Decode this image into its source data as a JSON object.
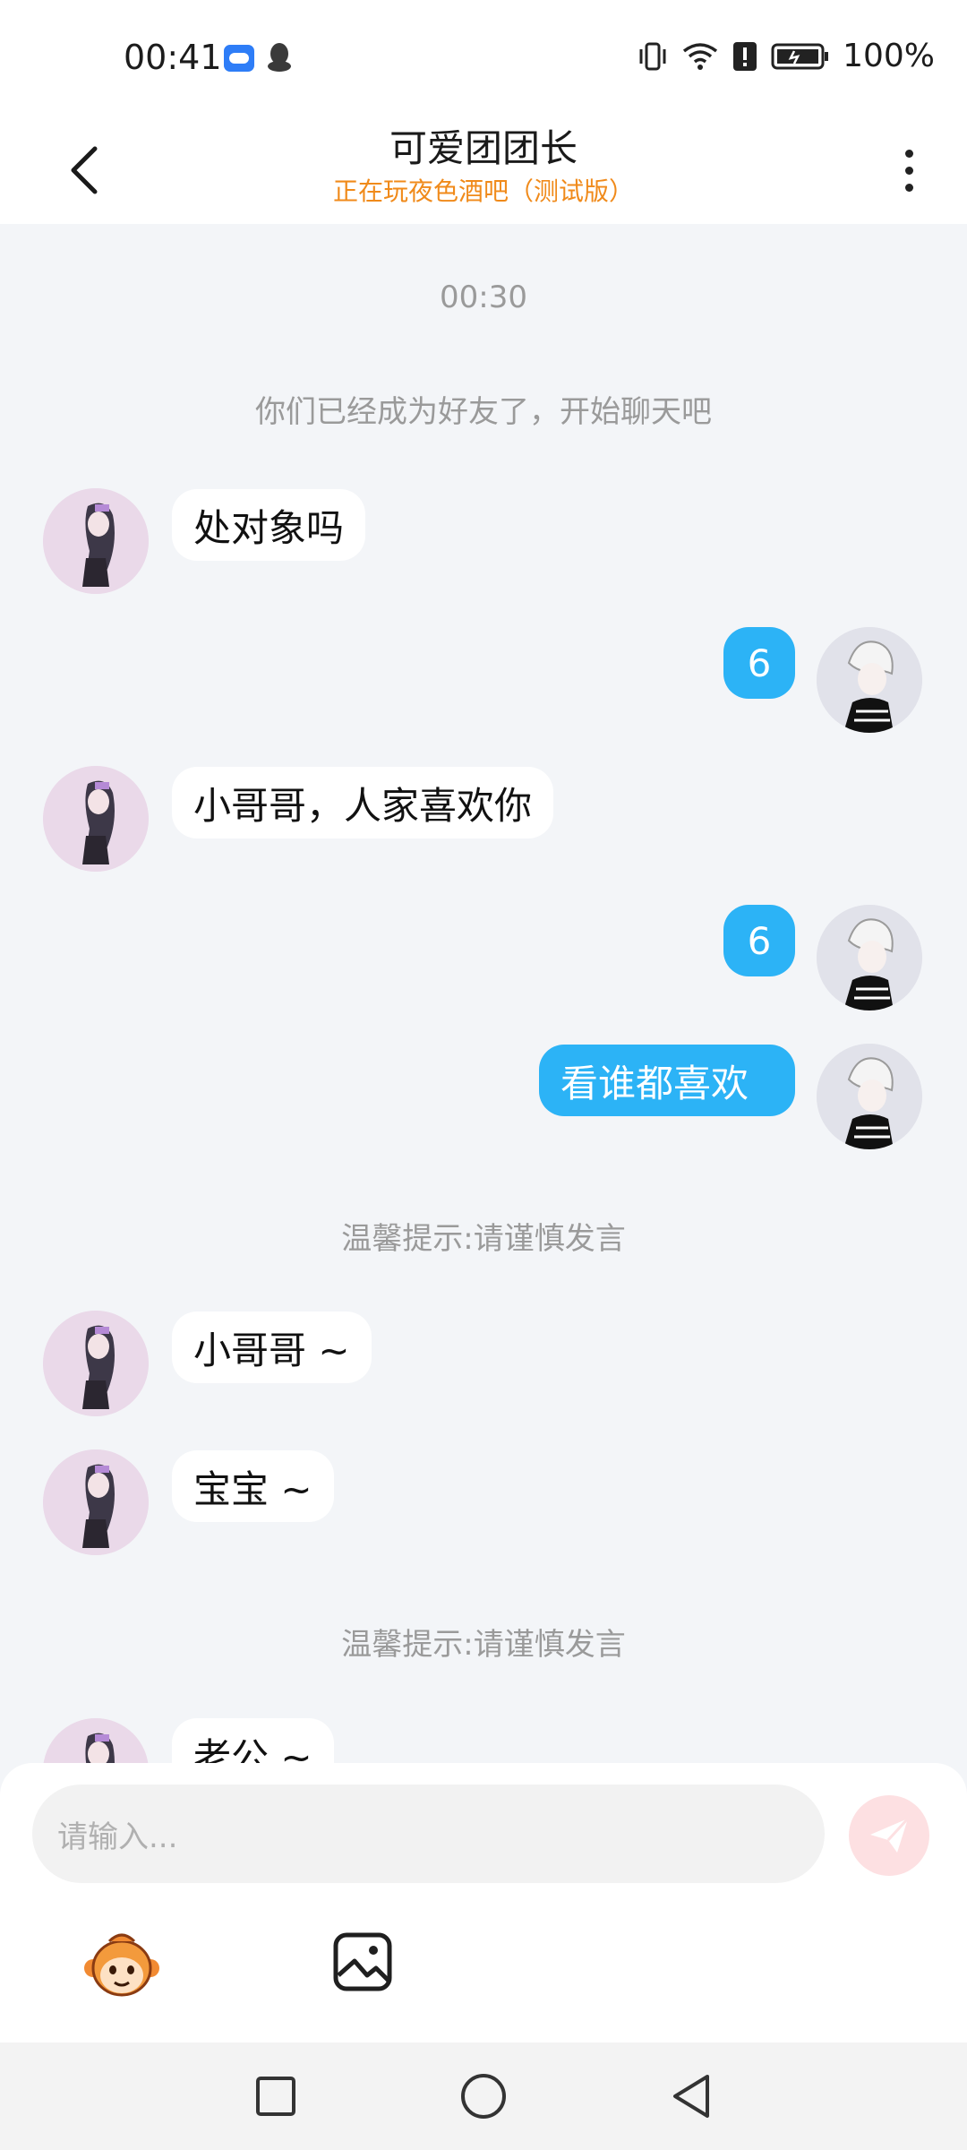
{
  "status_bar": {
    "time": "00:41",
    "battery": "100%",
    "icons": [
      "cloud-icon",
      "qq-icon",
      "vibrate-icon",
      "wifi-icon",
      "alert-icon",
      "battery-icon"
    ]
  },
  "header": {
    "title": "可爱团团长",
    "subtitle": "正在玩夜色酒吧（测试版）",
    "accent_color": "#f08a1a"
  },
  "chat": {
    "timestamp": "00:30",
    "friend_notice": "你们已经成为好友了，开始聊天吧",
    "messages": [
      {
        "from": "other",
        "text": "处对象吗"
      },
      {
        "from": "me",
        "text": "6"
      },
      {
        "from": "other",
        "text": "小哥哥，人家喜欢你"
      },
      {
        "from": "me",
        "text": "6"
      },
      {
        "from": "me",
        "text": "看谁都喜欢"
      },
      {
        "from": "other",
        "text": "小哥哥 ~"
      },
      {
        "from": "other",
        "text": "宝宝 ~"
      },
      {
        "from": "other",
        "text": "老公 ~"
      }
    ],
    "tips": [
      "温馨提示:请谨慎发言",
      "温馨提示:请谨慎发言"
    ],
    "out_bubble_color": "#2cb3f6",
    "in_bubble_color": "#ffffff"
  },
  "input": {
    "placeholder": "请输入..."
  },
  "nav": {
    "buttons": [
      "recent-apps",
      "home",
      "back"
    ]
  }
}
